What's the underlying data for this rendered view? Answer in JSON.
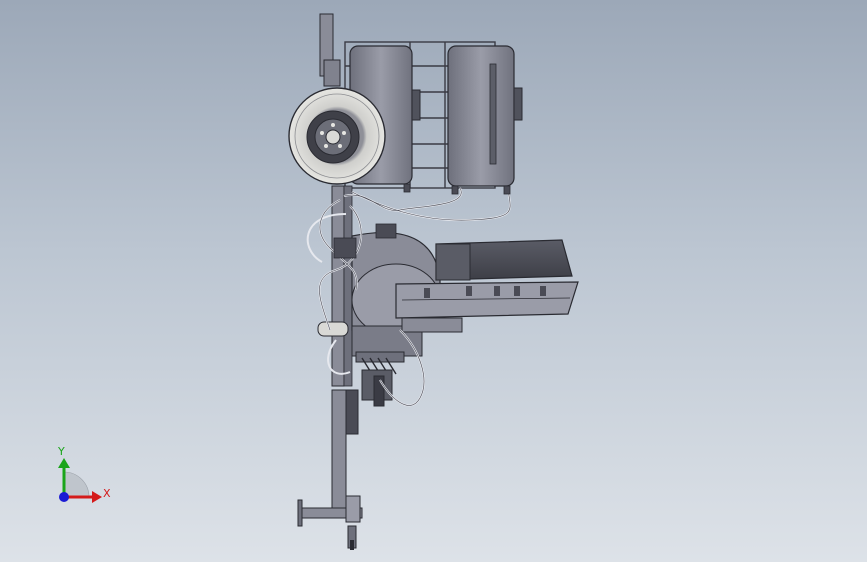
{
  "triad": {
    "y_label": "Y",
    "x_label": "X",
    "colors": {
      "x": "#d41a1a",
      "y": "#1aa51a",
      "z": "#1a1ad4"
    }
  },
  "model_colors": {
    "body": "#8a8c98",
    "body_dark": "#4a4b55",
    "outline": "#2a2b32",
    "tire": "#d9d9d6",
    "hose": "#e6e8ee"
  }
}
